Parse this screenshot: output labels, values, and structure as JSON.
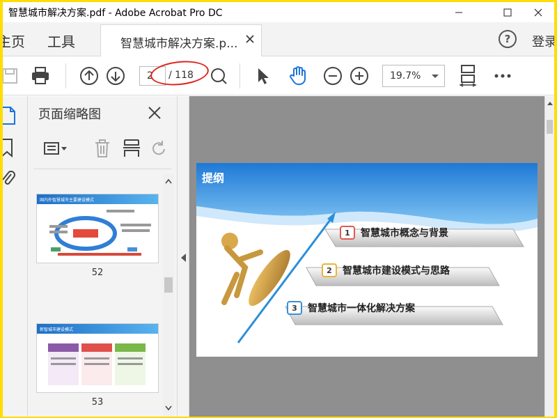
{
  "window": {
    "title": "智慧城市解决方案.pdf - Adobe Acrobat Pro DC"
  },
  "menu": {
    "home": "主页",
    "tools": "工具",
    "doc_tab": "智慧城市解决方案.p...",
    "help": "?",
    "signin": "登录"
  },
  "toolbar": {
    "current_page": "2",
    "total_pages": "/ 118",
    "zoom": "19.7%",
    "icons": [
      "save-icon",
      "print-icon",
      "page-up-icon",
      "page-down-icon",
      "fit-page-icon",
      "select-cursor-icon",
      "hand-icon",
      "zoom-out-icon",
      "zoom-in-icon",
      "scroll-mode-icon",
      "more-icon"
    ]
  },
  "thumbnails": {
    "title": "页面缩略图",
    "pages": [
      {
        "number": "52",
        "heading": "国内外智慧城市主要建设模式"
      },
      {
        "number": "53",
        "heading": "新智城市建设模式"
      }
    ]
  },
  "slide": {
    "title": "提纲",
    "items": [
      {
        "num": "1",
        "label": "智慧城市概念与背景",
        "badge_color": "#e05a4f"
      },
      {
        "num": "2",
        "label": "智慧城市建设模式与思路",
        "badge_color": "#e8b43a"
      },
      {
        "num": "3",
        "label": "智慧城市一体化解决方案",
        "badge_color": "#3a8fd6"
      }
    ]
  },
  "colors": {
    "frame": "#ffdd00",
    "annotation": "#e0231c",
    "slide_header": "#1e79d6",
    "doc_background": "#8f8f8f"
  }
}
